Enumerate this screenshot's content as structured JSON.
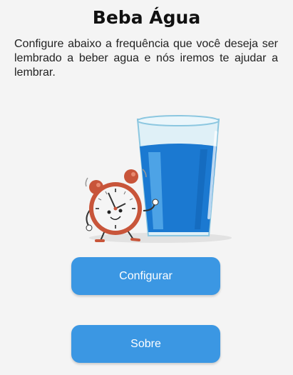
{
  "header": {
    "title": "Beba Água"
  },
  "main": {
    "description": "Configure abaixo a frequência que você deseja ser lembrado a beber agua e nós iremos te ajudar a lembrar."
  },
  "illustration": {
    "icons": [
      "alarm-clock-icon",
      "water-glass-icon"
    ]
  },
  "buttons": {
    "configure_label": "Configurar",
    "about_label": "Sobre"
  },
  "colors": {
    "accent": "#3b97e3",
    "water": "#1b79d1",
    "clock": "#c8553a"
  }
}
